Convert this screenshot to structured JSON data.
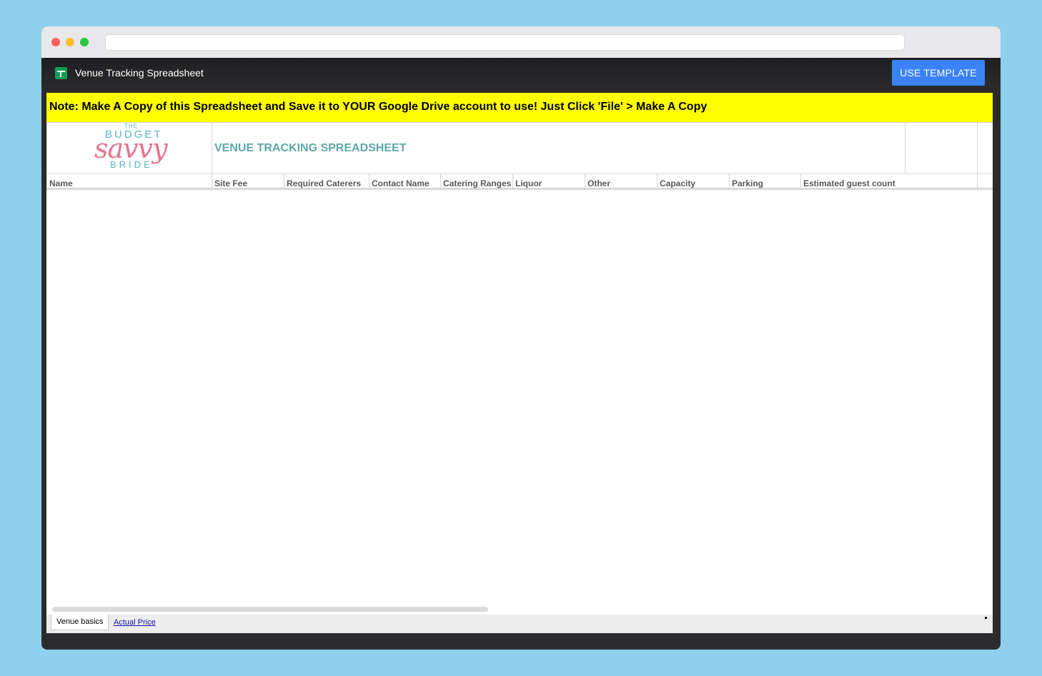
{
  "app": {
    "title": "Venue Tracking Spreadsheet",
    "use_template_label": "USE TEMPLATE",
    "accent_color": "#3b82f6"
  },
  "sheet": {
    "note": "Note: Make A Copy of this Spreadsheet and Save it to YOUR Google Drive account to use! Just Click 'File' > Make A Copy",
    "note_color": "#ffff00",
    "logo": {
      "the": "THE",
      "budget": "BUDGET",
      "savvy": "savvy",
      "bride": "BRIDE"
    },
    "title": "VENUE TRACKING SPREADSHEET",
    "columns": [
      "Name",
      "Site Fee",
      "Required Caterers",
      "Contact Name",
      "Catering Ranges",
      "Liquor",
      "Other",
      "Capacity",
      "Parking",
      "Estimated guest count"
    ]
  },
  "tabs": {
    "active": "Venue basics",
    "other": "Actual Price"
  },
  "icons": {
    "app_icon": "google-sheets-icon"
  }
}
